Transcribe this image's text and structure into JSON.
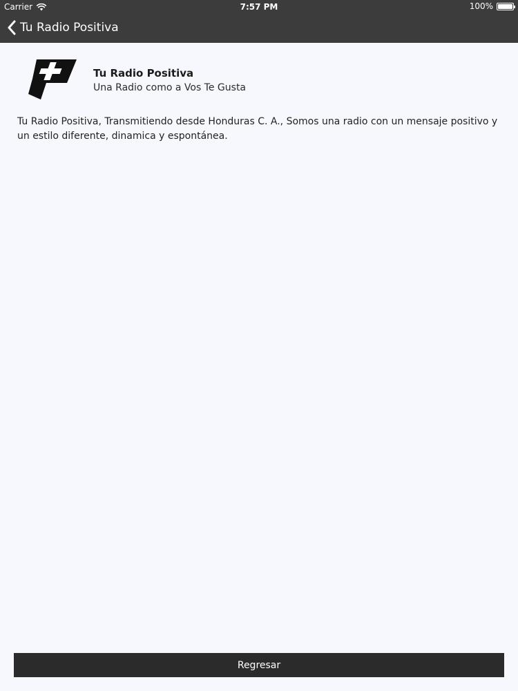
{
  "status_bar": {
    "carrier": "Carrier",
    "time": "7:57 PM",
    "battery": "100%",
    "battery_level": 1.0
  },
  "nav": {
    "back_label": "Tu Radio Positiva"
  },
  "header": {
    "title": "Tu Radio Positiva",
    "subtitle": "Una Radio como a Vos Te Gusta"
  },
  "description": "Tu Radio Positiva, Transmitiendo desde Honduras C. A., Somos una radio con un mensaje positivo y un estilo diferente, dinamica y espontánea.",
  "footer": {
    "button_label": "Regresar"
  },
  "colors": {
    "nav_background": "#3c3c3c",
    "page_background": "#f7f8fd",
    "button_background": "#2b2b2b"
  },
  "icons": {
    "status_wifi": "wifi-icon",
    "status_battery": "battery-icon",
    "back": "chevron-left-icon",
    "logo": "radio-positiva-logo"
  }
}
